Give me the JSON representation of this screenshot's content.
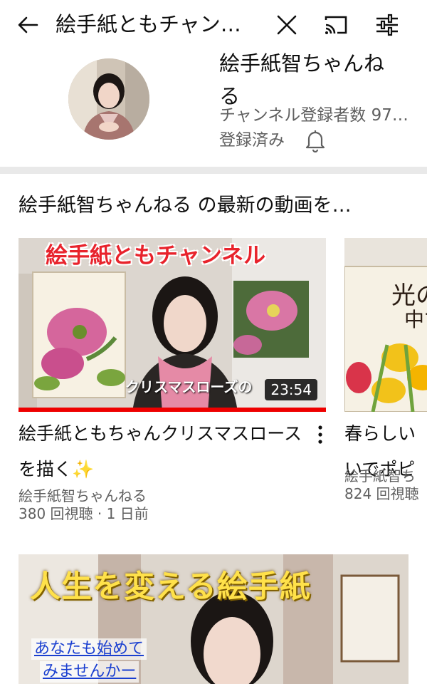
{
  "search": {
    "query": "絵手紙ともチャン…"
  },
  "channel": {
    "name": "絵手紙智ちゃんね\nる",
    "subscribers": "チャンネル登録者数 97…",
    "subscribed_label": "登録済み"
  },
  "shelf": {
    "title": "絵手紙智ちゃんねる の最新の動画を…",
    "videos": [
      {
        "title": "絵手紙ともちゃんクリスマスロースを描く✨",
        "channel": "絵手紙智ちゃんねる",
        "meta": "380 回視聴 · 1 日前",
        "duration": "23:54",
        "thumb_heading": "絵手紙ともチャンネル",
        "thumb_caption": "クリスマスローズの",
        "progress": 1.0
      },
      {
        "title": "春らしい\nいでポピ",
        "channel": "絵手紙智ち",
        "meta": "824 回視聴"
      }
    ]
  },
  "second_video": {
    "thumb_heading": "人生を変える絵手紙",
    "thumb_line1": "あなたも始めて",
    "thumb_line2": "みませんかー"
  },
  "icons": {
    "back": "back-arrow-icon",
    "clear": "close-icon",
    "cast": "cast-icon",
    "filter": "filter-icon",
    "bell": "bell-icon",
    "more": "more-vertical-icon"
  },
  "colors": {
    "text_primary": "#0f0f0f",
    "text_secondary": "#606060",
    "progress": "#ee0000",
    "duration_bg": "#000000",
    "heading_red": "#e8232c",
    "heading_yellow": "#ffe14a",
    "divider": "#e9e9e9"
  }
}
